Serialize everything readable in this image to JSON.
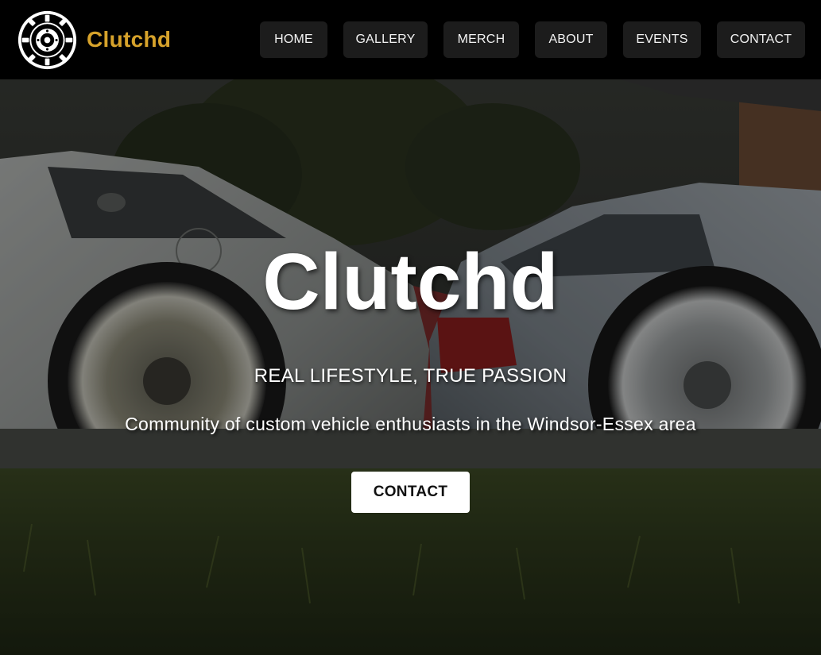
{
  "brand": {
    "name": "Clutchd",
    "logo_icon": "clutch-disc-icon",
    "color": "#d6a22b"
  },
  "nav": {
    "items": [
      {
        "label": "HOME"
      },
      {
        "label": "GALLERY"
      },
      {
        "label": "MERCH"
      },
      {
        "label": "ABOUT"
      },
      {
        "label": "EVENTS"
      },
      {
        "label": "CONTACT"
      }
    ]
  },
  "hero": {
    "title": "Clutchd",
    "tagline": "REAL LIFESTYLE, TRUE PASSION",
    "description": "Community of custom vehicle enthusiasts in the Windsor-Essex area",
    "cta_label": "CONTACT"
  },
  "colors": {
    "header_bg": "#000000",
    "nav_button_bg": "#1c1c1c",
    "accent": "#d6a22b",
    "cta_bg": "#ffffff"
  }
}
